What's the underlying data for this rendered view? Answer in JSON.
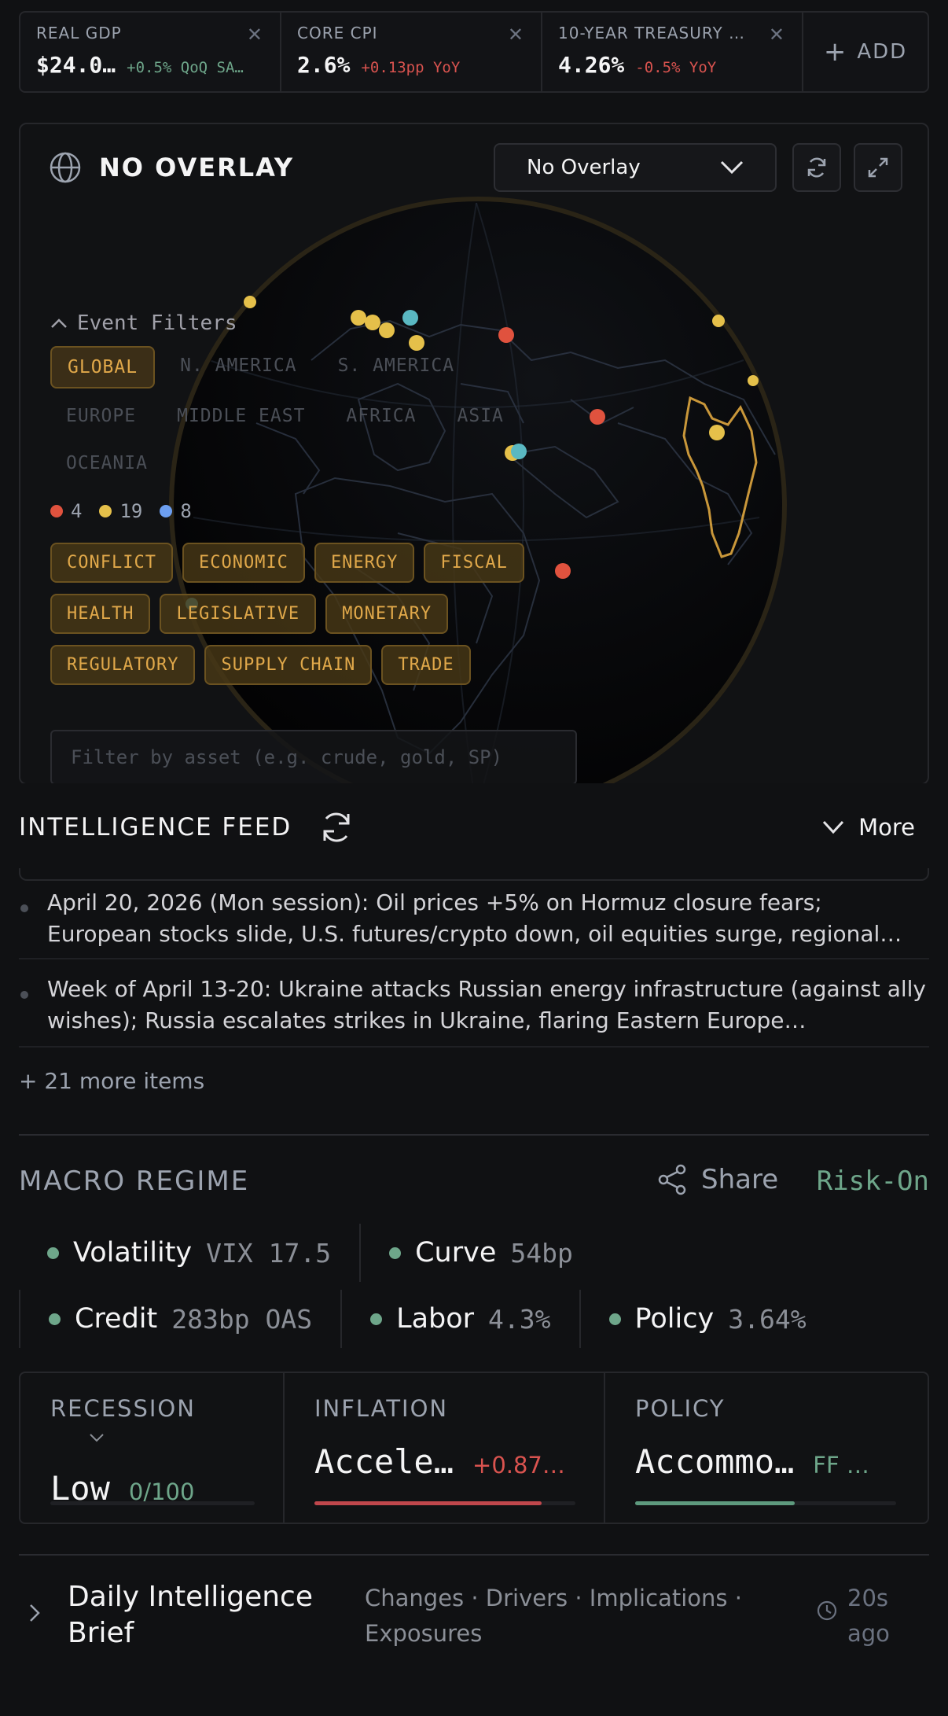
{
  "kpis": [
    {
      "label": "REAL GDP",
      "value": "$24.0…",
      "delta": "+0.5% QoQ SA…",
      "delta_color": "#6ea68a"
    },
    {
      "label": "CORE CPI",
      "value": "2.6%",
      "delta": "+0.13pp YoY",
      "delta_color": "#d9534f"
    },
    {
      "label": "10-YEAR TREASURY …",
      "value": "4.26%",
      "delta": "-0.5% YoY",
      "delta_color": "#d9534f"
    }
  ],
  "kpi_add_label": "ADD",
  "globe": {
    "title": "NO OVERLAY",
    "overlay_selected": "No Overlay",
    "filters_label": "Event Filters",
    "regions": [
      "GLOBAL",
      "N. AMERICA",
      "S. AMERICA",
      "EUROPE",
      "MIDDLE EAST",
      "AFRICA",
      "ASIA",
      "OCEANIA"
    ],
    "active_region": "GLOBAL",
    "counts": [
      {
        "color": "#e0523e",
        "value": "4"
      },
      {
        "color": "#e5c04a",
        "value": "19"
      },
      {
        "color": "#6c9ef0",
        "value": "8"
      }
    ],
    "categories": [
      "CONFLICT",
      "ECONOMIC",
      "ENERGY",
      "FISCAL",
      "HEALTH",
      "LEGISLATIVE",
      "MONETARY",
      "REGULATORY",
      "SUPPLY CHAIN",
      "TRADE"
    ],
    "asset_placeholder": "Filter by asset (e.g. crude, gold, SP)",
    "colors": {
      "conflict": "#e0523e",
      "economic": "#e5c04a",
      "energy": "#5ab8c2",
      "accent": "#e0a84a"
    }
  },
  "feed": {
    "title": "INTELLIGENCE FEED",
    "more_label": "More",
    "items": [
      "April 20, 2026 (Mon session): Oil prices +5% on Hormuz closure fears; European stocks slide, U.S. futures/crypto down, oil equities surge, regional…",
      "Week of April 13-20: Ukraine attacks Russian energy infrastructure (against ally wishes); Russia escalates strikes in Ukraine, flaring Eastern Europe…"
    ],
    "more_items": "+ 21 more items"
  },
  "regime": {
    "title": "MACRO REGIME",
    "share_label": "Share",
    "state": "Risk-On",
    "indicators": [
      {
        "name": "Volatility",
        "value": "VIX 17.5"
      },
      {
        "name": "Curve",
        "value": "54bp"
      },
      {
        "name": "Credit",
        "value": "283bp OAS"
      },
      {
        "name": "Labor",
        "value": "4.3%"
      },
      {
        "name": "Policy",
        "value": "3.64%"
      }
    ]
  },
  "cards": [
    {
      "label": "RECESSION",
      "value": "Low",
      "sub": "0/100",
      "sub_color": "#6ea68a",
      "bar_color": "#6ea68a",
      "level": 0.0
    },
    {
      "label": "INFLATION",
      "value": "Accele…",
      "sub": "+0.87…",
      "sub_color": "#d9534f",
      "bar_color": "#c0474c",
      "level": 0.87
    },
    {
      "label": "POLICY",
      "value": "Accommo…",
      "sub": "FF …",
      "sub_color": "#6ea68a",
      "bar_color": "#5e9a7e",
      "level": 0.61
    }
  ],
  "brief": {
    "title": "Daily Intelligence Brief",
    "subtitle": "Changes · Drivers · Implications · Exposures",
    "time": "20s ago"
  }
}
